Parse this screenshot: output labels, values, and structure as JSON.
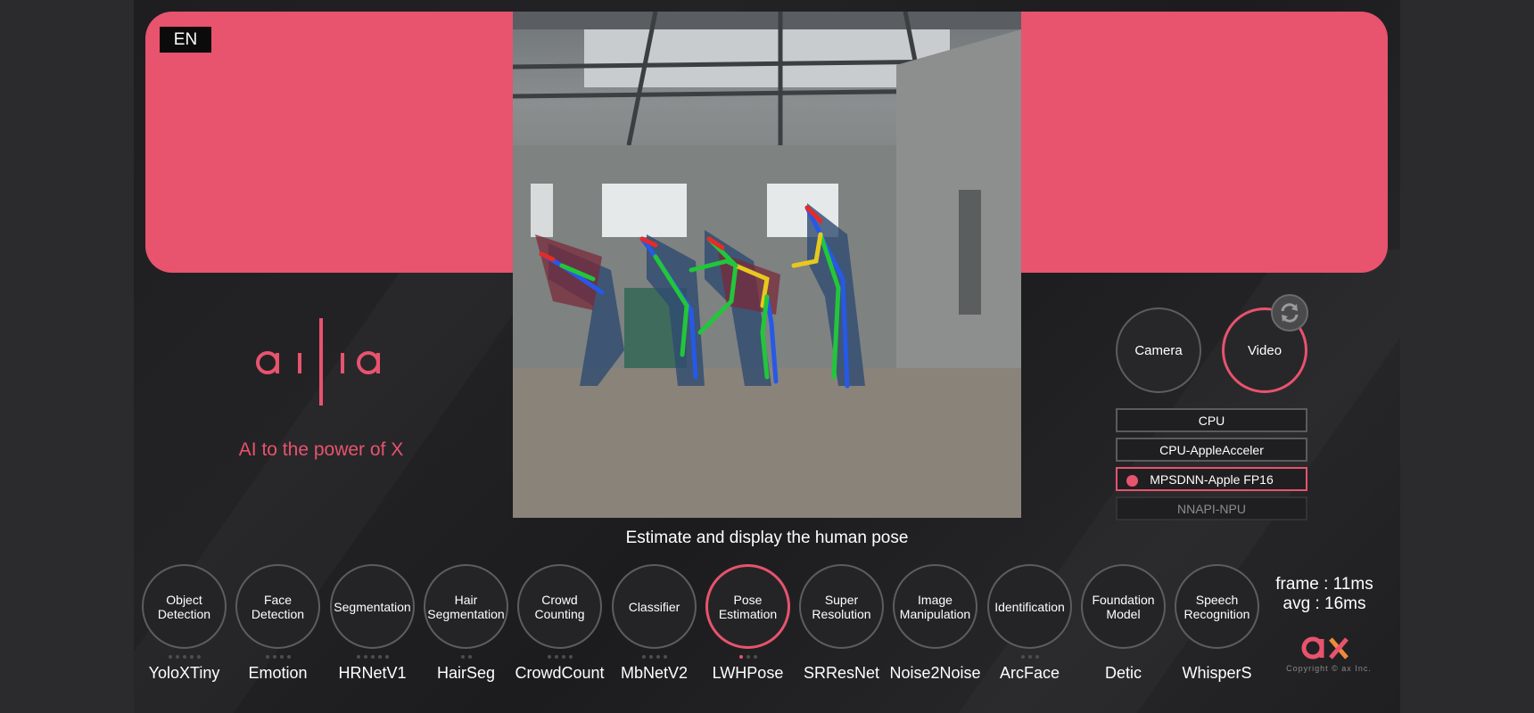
{
  "header": {
    "language": "EN"
  },
  "brand": {
    "logo_text": "ailia",
    "tagline": "AI to the power of X",
    "accent_color": "#e8536e"
  },
  "source": {
    "camera_label": "Camera",
    "video_label": "Video",
    "selected": "Video",
    "refresh_icon": "refresh-icon"
  },
  "devices": [
    {
      "label": "CPU",
      "state": "normal"
    },
    {
      "label": "CPU-AppleAcceler",
      "state": "normal"
    },
    {
      "label": "MPSDNN-Apple FP16",
      "state": "selected"
    },
    {
      "label": "NNAPI-NPU",
      "state": "disabled"
    }
  ],
  "main": {
    "description": "Estimate and display the human pose"
  },
  "tasks": [
    {
      "label": "Object\nDetection",
      "model": "YoloXTiny",
      "dots": 5,
      "active_dot": -1
    },
    {
      "label": "Face\nDetection",
      "model": "Emotion",
      "dots": 4,
      "active_dot": -1
    },
    {
      "label": "Segmentation",
      "model": "HRNetV1",
      "dots": 5,
      "active_dot": -1
    },
    {
      "label": "Hair\nSegmentation",
      "model": "HairSeg",
      "dots": 2,
      "active_dot": -1
    },
    {
      "label": "Crowd\nCounting",
      "model": "CrowdCount",
      "dots": 4,
      "active_dot": -1
    },
    {
      "label": "Classifier",
      "model": "MbNetV2",
      "dots": 4,
      "active_dot": -1
    },
    {
      "label": "Pose\nEstimation",
      "model": "LWHPose",
      "dots": 3,
      "active_dot": 0,
      "active": true
    },
    {
      "label": "Super\nResolution",
      "model": "SRResNet",
      "dots": 0,
      "active_dot": -1
    },
    {
      "label": "Image\nManipulation",
      "model": "Noise2Noise",
      "dots": 0,
      "active_dot": -1
    },
    {
      "label": "Identification",
      "model": "ArcFace",
      "dots": 3,
      "active_dot": -1
    },
    {
      "label": "Foundation\nModel",
      "model": "Detic",
      "dots": 0,
      "active_dot": -1
    },
    {
      "label": "Speech\nRecognition",
      "model": "WhisperS",
      "dots": 0,
      "active_dot": -1
    }
  ],
  "timing": {
    "frame": "frame : 11ms",
    "avg": "avg : 16ms"
  },
  "footer": {
    "company_logo": "ax",
    "copyright": "Copyright © ax Inc."
  }
}
